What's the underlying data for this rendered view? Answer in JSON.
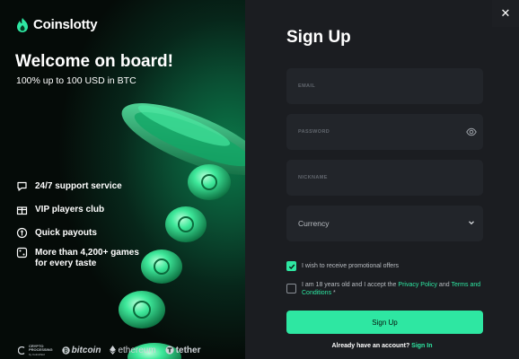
{
  "brand": {
    "name": "Coinslotty"
  },
  "hero": {
    "title": "Welcome on board!",
    "subtitle": "100% up to 100 USD in BTC"
  },
  "features": [
    {
      "icon": "chat-bubble-icon",
      "label": "24/7 support service"
    },
    {
      "icon": "gift-box-icon",
      "label": "VIP players club"
    },
    {
      "icon": "coin-stack-icon",
      "label": "Quick payouts"
    },
    {
      "icon": "dice-icon",
      "label": "More than 4,200+ games",
      "label2": "for every taste"
    }
  ],
  "partners": {
    "crypto_processing": {
      "line1": "CRYPTO",
      "line2": "PROCESSING",
      "line3": "by CoinsPaid"
    },
    "bitcoin": "bitcoin",
    "ethereum": "ethereum",
    "tether": "tether"
  },
  "form": {
    "title": "Sign Up",
    "email_label": "EMAIL",
    "password_label": "PASSWORD",
    "nickname_label": "NICKNAME",
    "currency_value": "Currency",
    "promo_checkbox_label": "I wish to receive promotional offers",
    "promo_checked": true,
    "terms_prefix": "I am 18 years old and I accept the ",
    "privacy_link": "Privacy Policy",
    "terms_and": " and ",
    "terms_link": "Terms and Conditions",
    "terms_suffix": " *",
    "terms_checked": false,
    "submit_label": "Sign Up",
    "already_text": "Already have an account? ",
    "signin_link": "Sign In"
  },
  "colors": {
    "accent": "#2ee7a2",
    "panel_bg": "#1b1d21",
    "field_bg": "#22252a"
  },
  "close_icon": "close-icon"
}
